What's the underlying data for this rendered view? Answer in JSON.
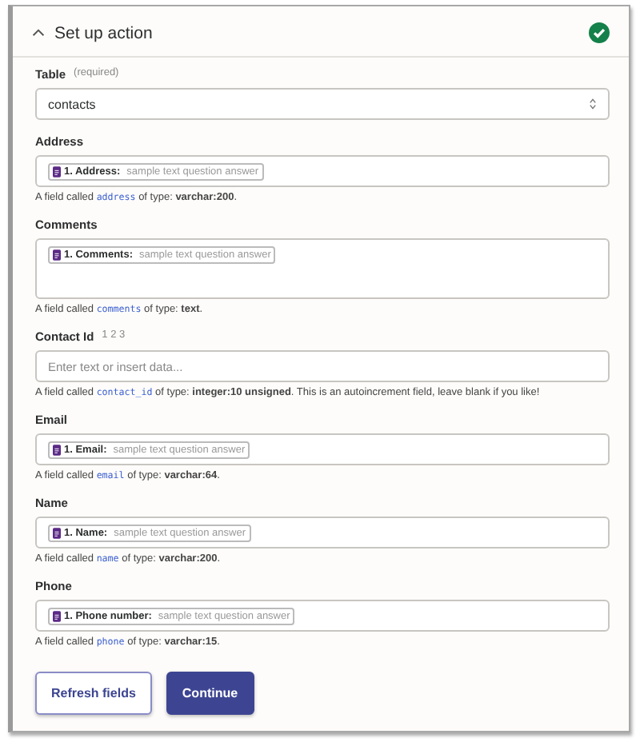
{
  "header": {
    "title": "Set up action",
    "expanded": true,
    "complete": true
  },
  "table": {
    "label": "Table",
    "note": "(required)",
    "value": "contacts"
  },
  "fields": [
    {
      "kind": "pill",
      "label": "Address",
      "multiline": false,
      "token": "1. Address:",
      "sample": "sample text question answer",
      "hint": {
        "before": "A field called",
        "code": "address",
        "after": "of type: **varchar:200**."
      }
    },
    {
      "kind": "pill",
      "label": "Comments",
      "multiline": true,
      "token": "1. Comments:",
      "sample": "sample text question answer",
      "hint": {
        "before": "A field called",
        "code": "comments",
        "after": "of type: **text**."
      }
    },
    {
      "kind": "text",
      "label": "Contact Id",
      "note": "1 2 3",
      "multiline": false,
      "placeholder": "Enter text or insert data...",
      "hint": {
        "before": "A field called",
        "code": "contact_id",
        "after": "of type: **integer:10 unsigned**. This is an autoincrement field, leave blank if you like!"
      }
    },
    {
      "kind": "pill",
      "label": "Email",
      "multiline": false,
      "token": "1. Email:",
      "sample": "sample text question answer",
      "hint": {
        "before": "A field called",
        "code": "email",
        "after": "of type: **varchar:64**."
      }
    },
    {
      "kind": "pill",
      "label": "Name",
      "multiline": false,
      "token": "1. Name:",
      "sample": "sample text question answer",
      "hint": {
        "before": "A field called",
        "code": "name",
        "after": "of type: **varchar:200**."
      }
    },
    {
      "kind": "pill",
      "label": "Phone",
      "multiline": false,
      "token": "1. Phone number:",
      "sample": "sample text question answer",
      "hint": {
        "before": "A field called",
        "code": "phone",
        "after": "of type: **varchar:15**."
      }
    }
  ],
  "buttons": [
    {
      "label": "Refresh fields",
      "primary": false
    },
    {
      "label": "Continue",
      "primary": true
    }
  ]
}
